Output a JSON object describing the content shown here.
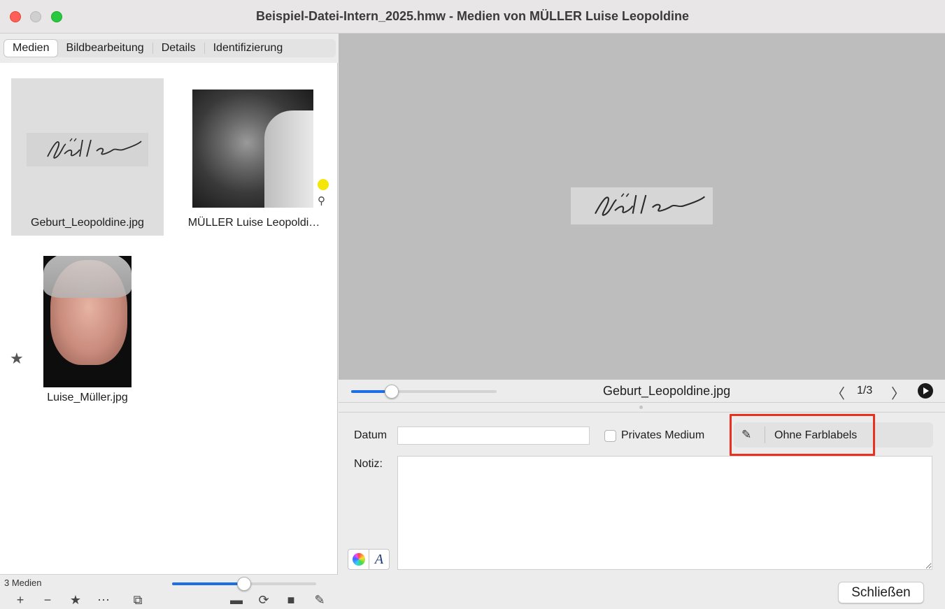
{
  "window": {
    "title": "Beispiel-Datei-Intern_2025.hmw - Medien von MÜLLER Luise Leopoldine"
  },
  "tabs": [
    {
      "label": "Medien",
      "active": true
    },
    {
      "label": "Bildbearbeitung",
      "active": false
    },
    {
      "label": "Details",
      "active": false
    },
    {
      "label": "Identifizierung",
      "active": false
    }
  ],
  "media": [
    {
      "name": "Geburt_Leopoldine.jpg",
      "selected": true
    },
    {
      "name": "MÜLLER Luise Leopoldi…",
      "selected": false,
      "color_label": "#f5e60a",
      "icon": "pin-icon"
    },
    {
      "name": "Luise_Müller.jpg",
      "selected": false,
      "icon": "star-icon"
    }
  ],
  "status": {
    "count": "3 Medien",
    "thumb_size_fraction": 0.5
  },
  "toolbar": {
    "icons": [
      "plus-icon",
      "minus-icon",
      "star-icon",
      "more-icon",
      "slideshow-icon",
      "folder-icon",
      "refresh-icon",
      "save-icon",
      "edit-icon"
    ],
    "symbols": {
      "plus": "+",
      "minus": "−",
      "star": "★",
      "more": "⋯",
      "slideshow": "⧉",
      "folder": "▬",
      "refresh": "⟳",
      "save": "■",
      "edit": "✎"
    }
  },
  "viewer": {
    "filename": "Geburt_Leopoldine.jpg",
    "page": "1/3",
    "zoom_fraction": 0.28,
    "prev_symbol": "〈",
    "next_symbol": "〉"
  },
  "details": {
    "date_label": "Datum",
    "date_value": "",
    "private_label": "Privates Medium",
    "private_checked": false,
    "color_label": "Ohne Farblabels",
    "note_label": "Notiz:",
    "note_value": "",
    "close_label": "Schließen"
  },
  "colors": {
    "accent": "#1e6ee6",
    "highlight": "#e8311f"
  }
}
